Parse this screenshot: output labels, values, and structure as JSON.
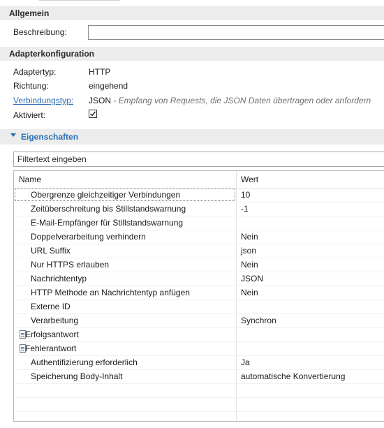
{
  "general": {
    "header": "Allgemein",
    "description_label": "Beschreibung:",
    "description_value": ""
  },
  "adapter": {
    "header": "Adapterkonfiguration",
    "type_label": "Adaptertyp:",
    "type_value": "HTTP",
    "direction_label": "Richtung:",
    "direction_value": "eingehend",
    "connection_label": "Verbindungstyp:",
    "connection_value": "JSON",
    "connection_desc": " - Empfang von Requests, die JSON Daten übertragen oder anfordern",
    "active_label": "Aktiviert:",
    "active_checked": true
  },
  "properties": {
    "header": "Eigenschaften",
    "filter_placeholder": "Filtertext eingeben",
    "columns": {
      "name": "Name",
      "value": "Wert"
    },
    "rows": [
      {
        "name": "Obergrenze gleichzeitiger Verbindungen",
        "value": "10",
        "icon": null,
        "selected": true
      },
      {
        "name": "Zeitüberschreitung bis Stillstandswarnung",
        "value": "-1",
        "icon": null
      },
      {
        "name": "E-Mail-Empfänger für Stillstandswarnung",
        "value": "",
        "icon": null
      },
      {
        "name": "Doppelverarbeitung verhindern",
        "value": "Nein",
        "icon": null
      },
      {
        "name": "URL Suffix",
        "value": "json",
        "icon": null
      },
      {
        "name": "Nur HTTPS erlauben",
        "value": "Nein",
        "icon": null
      },
      {
        "name": "Nachrichtentyp",
        "value": "JSON",
        "icon": null
      },
      {
        "name": "HTTP Methode an Nachrichtentyp anfügen",
        "value": "Nein",
        "icon": null
      },
      {
        "name": "Externe ID",
        "value": "",
        "icon": null
      },
      {
        "name": "Verarbeitung",
        "value": "Synchron",
        "icon": null
      },
      {
        "name": "Erfolgsantwort",
        "value": "",
        "icon": "document-icon"
      },
      {
        "name": "Fehlerantwort",
        "value": "",
        "icon": "document-icon"
      },
      {
        "name": "Authentifizierung erforderlich",
        "value": "Ja",
        "icon": null
      },
      {
        "name": "Speicherung Body-Inhalt",
        "value": "automatische Konvertierung",
        "icon": null
      },
      {
        "name": "",
        "value": "",
        "icon": null
      },
      {
        "name": "",
        "value": "",
        "icon": null
      },
      {
        "name": "",
        "value": "",
        "icon": null
      },
      {
        "name": "",
        "value": "",
        "icon": null
      }
    ]
  },
  "colors": {
    "accent": "#2a6fb5",
    "header_bg": "#ececec"
  }
}
